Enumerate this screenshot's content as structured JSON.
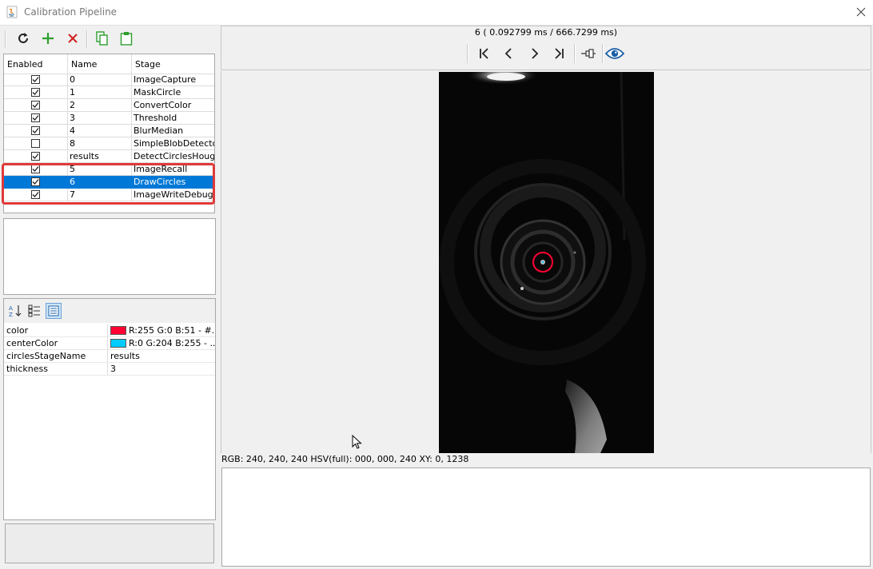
{
  "window": {
    "title": "Calibration Pipeline"
  },
  "stages": {
    "columns": [
      "Enabled",
      "Name",
      "Stage"
    ],
    "rows": [
      {
        "enabled": true,
        "name": "0",
        "stage": "ImageCapture",
        "selected": false
      },
      {
        "enabled": true,
        "name": "1",
        "stage": "MaskCircle",
        "selected": false
      },
      {
        "enabled": true,
        "name": "2",
        "stage": "ConvertColor",
        "selected": false
      },
      {
        "enabled": true,
        "name": "3",
        "stage": "Threshold",
        "selected": false
      },
      {
        "enabled": true,
        "name": "4",
        "stage": "BlurMedian",
        "selected": false
      },
      {
        "enabled": false,
        "name": "8",
        "stage": "SimpleBlobDetector",
        "selected": false
      },
      {
        "enabled": true,
        "name": "results",
        "stage": "DetectCirclesHough",
        "selected": false
      },
      {
        "enabled": true,
        "name": "5",
        "stage": "ImageRecall",
        "selected": false
      },
      {
        "enabled": true,
        "name": "6",
        "stage": "DrawCircles",
        "selected": true
      },
      {
        "enabled": true,
        "name": "7",
        "stage": "ImageWriteDebug",
        "selected": false
      }
    ]
  },
  "properties": [
    {
      "name": "color",
      "value": "R:255 G:0 B:51 - #...",
      "swatch": "#ff0033"
    },
    {
      "name": "centerColor",
      "value": "R:0 G:204 B:255 - ...",
      "swatch": "#00ccff"
    },
    {
      "name": "circlesStageName",
      "value": "results"
    },
    {
      "name": "thickness",
      "value": "3"
    }
  ],
  "viewer": {
    "frame_info": "6 ( 0.092799 ms / 666.7299 ms)",
    "status": "RGB: 240, 240, 240 HSV(full): 000, 000, 240 XY: 0, 1238"
  },
  "colors": {
    "selection": "#0078d7",
    "highlight": "#e03a3a",
    "add_icon": "#2e9d2e",
    "remove_icon": "#d01f1f",
    "eye_icon": "#1a5fa8"
  }
}
